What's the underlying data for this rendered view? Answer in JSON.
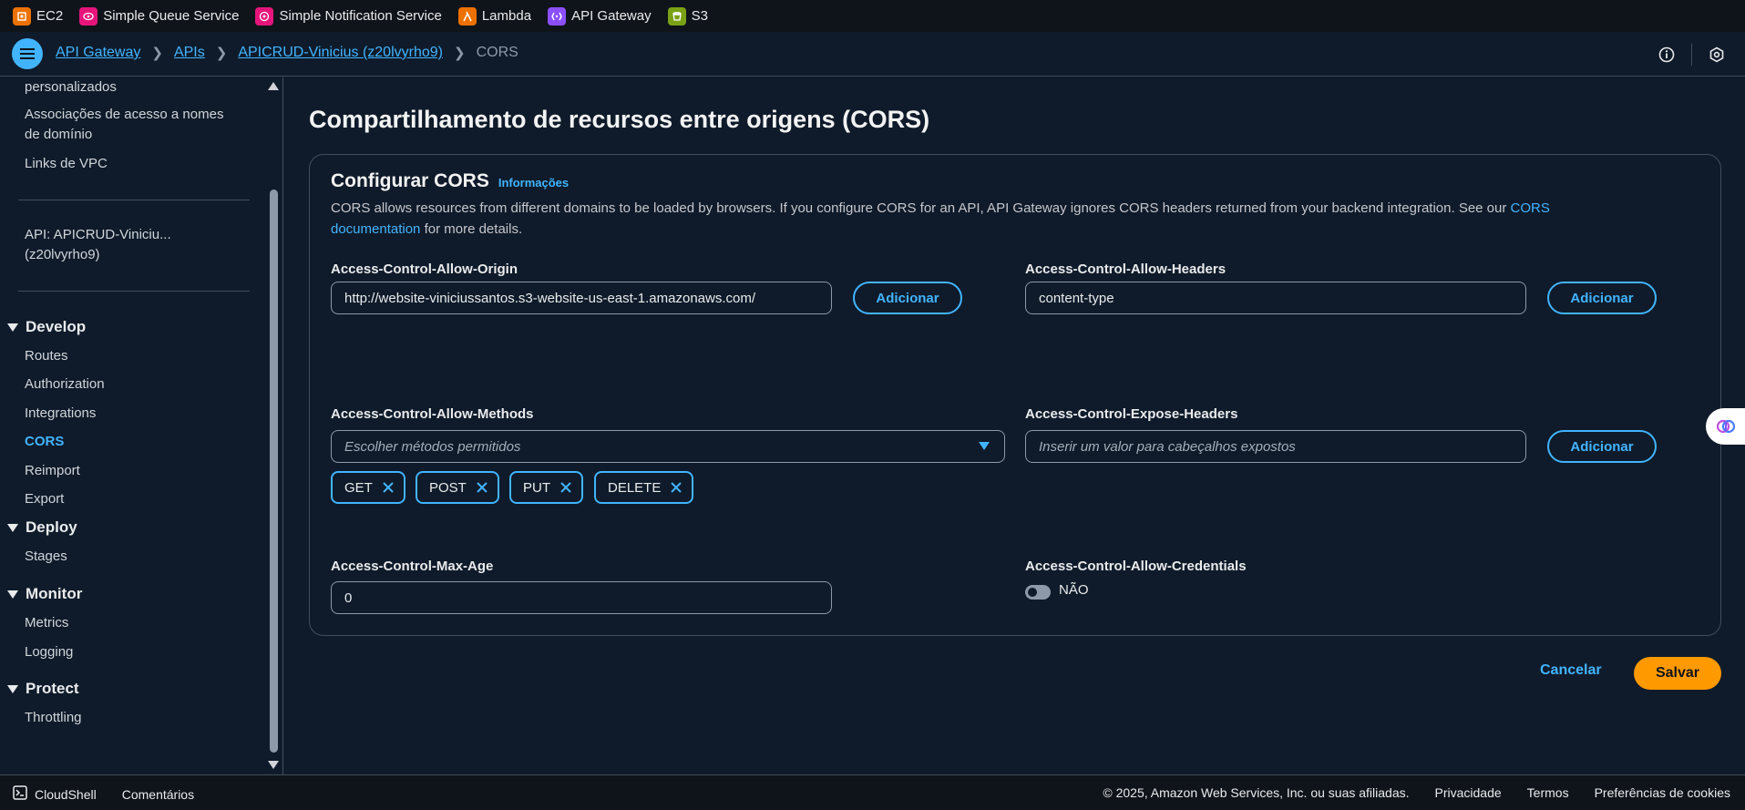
{
  "favorites": [
    {
      "label": "EC2",
      "icon": "ec2-icon",
      "color": "#ed7100"
    },
    {
      "label": "Simple Queue Service",
      "icon": "sqs-icon",
      "color": "#e7157b"
    },
    {
      "label": "Simple Notification Service",
      "icon": "sns-icon",
      "color": "#e7157b"
    },
    {
      "label": "Lambda",
      "icon": "lambda-icon",
      "color": "#ed7100"
    },
    {
      "label": "API Gateway",
      "icon": "api-gateway-icon",
      "color": "#8c4fff"
    },
    {
      "label": "S3",
      "icon": "s3-icon",
      "color": "#7aa116"
    }
  ],
  "breadcrumb": {
    "items": [
      "API Gateway",
      "APIs",
      "APICRUD-Vinicius (z20lvyrho9)"
    ],
    "current": "CORS"
  },
  "sidebar": {
    "top_items": [
      "personalizados",
      "Associações de acesso a nomes",
      "de domínio",
      "Links de VPC"
    ],
    "api_label_line1": "API: APICRUD-Viniciu...",
    "api_label_line2": "(z20lvyrho9)",
    "sections": [
      {
        "title": "Develop",
        "items": [
          "Routes",
          "Authorization",
          "Integrations",
          "CORS",
          "Reimport",
          "Export"
        ]
      },
      {
        "title": "Deploy",
        "items": [
          "Stages"
        ]
      },
      {
        "title": "Monitor",
        "items": [
          "Metrics",
          "Logging"
        ]
      },
      {
        "title": "Protect",
        "items": [
          "Throttling"
        ]
      }
    ],
    "active_item": "CORS"
  },
  "main": {
    "title": "Compartilhamento de recursos entre origens (CORS)",
    "panel_title": "Configurar CORS",
    "info_link": "Informações",
    "desc_text": "CORS allows resources from different domains to be loaded by browsers. If you configure CORS for an API, API Gateway ignores CORS headers returned from your backend integration. See our",
    "desc_link_1": "CORS",
    "desc_link_2": "documentation",
    "desc_tail": "for more details.",
    "allow_origin": {
      "label": "Access-Control-Allow-Origin",
      "value": "http://website-viniciussantos.s3-website-us-east-1.amazonaws.com/",
      "button": "Adicionar"
    },
    "allow_headers": {
      "label": "Access-Control-Allow-Headers",
      "value": "content-type",
      "button": "Adicionar"
    },
    "allow_methods": {
      "label": "Access-Control-Allow-Methods",
      "placeholder": "Escolher métodos permitidos",
      "tokens": [
        "GET",
        "POST",
        "PUT",
        "DELETE"
      ]
    },
    "expose_headers": {
      "label": "Access-Control-Expose-Headers",
      "placeholder": "Inserir um valor para cabeçalhos expostos",
      "button": "Adicionar"
    },
    "max_age": {
      "label": "Access-Control-Max-Age",
      "value": "0"
    },
    "allow_credentials": {
      "label": "Access-Control-Allow-Credentials",
      "toggle_text": "NÃO",
      "enabled": false
    },
    "cancel": "Cancelar",
    "save": "Salvar"
  },
  "footer": {
    "cloudshell": "CloudShell",
    "feedback": "Comentários",
    "copyright": "© 2025, Amazon Web Services, Inc. ou suas afiliadas.",
    "privacy": "Privacidade",
    "terms": "Termos",
    "cookies": "Preferências de cookies"
  },
  "colors": {
    "accent": "#42b4ff",
    "primary_button": "#ff9900",
    "background": "#0f1b2a"
  }
}
